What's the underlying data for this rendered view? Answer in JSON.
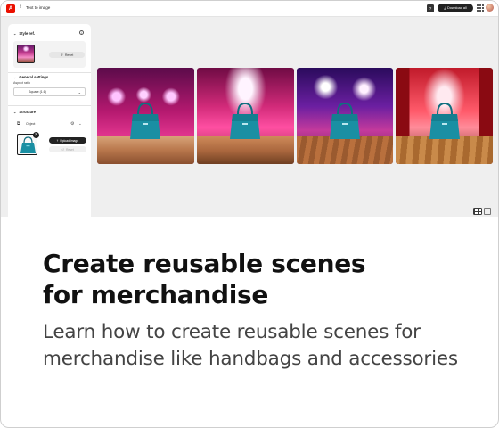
{
  "topbar": {
    "logo_text": "A",
    "breadcrumb": "Text to image",
    "download_label": "Download all"
  },
  "panel": {
    "style_section": {
      "title": "Style ref.",
      "reset_label": "Reset"
    },
    "general_section": {
      "title": "General settings",
      "aspect_label": "Aspect ratio",
      "aspect_value": "Square (1:1)"
    },
    "structure_section": {
      "title": "Structure",
      "object_label": "Object",
      "upload_label": "Upload image",
      "reset_label": "Reset"
    }
  },
  "results": {
    "images": [
      {
        "alt": "Teal handbag on wooden table, pink stage lights"
      },
      {
        "alt": "Teal handbag on wooden table, bright pink marquee lights"
      },
      {
        "alt": "Teal handbag on wooden stage, purple concert lights"
      },
      {
        "alt": "Teal handbag on wooden stage, red theater curtains"
      }
    ]
  },
  "headline": {
    "line1": "Create reusable scenes",
    "line2": "for merchandise"
  },
  "subline": {
    "line1": "Learn how to create reusable scenes for",
    "line2": "merchandise like handbags and accessories"
  },
  "colors": {
    "accent_red": "#eb1000",
    "dark_button": "#222222",
    "bag_teal": "#1a8fa3"
  }
}
